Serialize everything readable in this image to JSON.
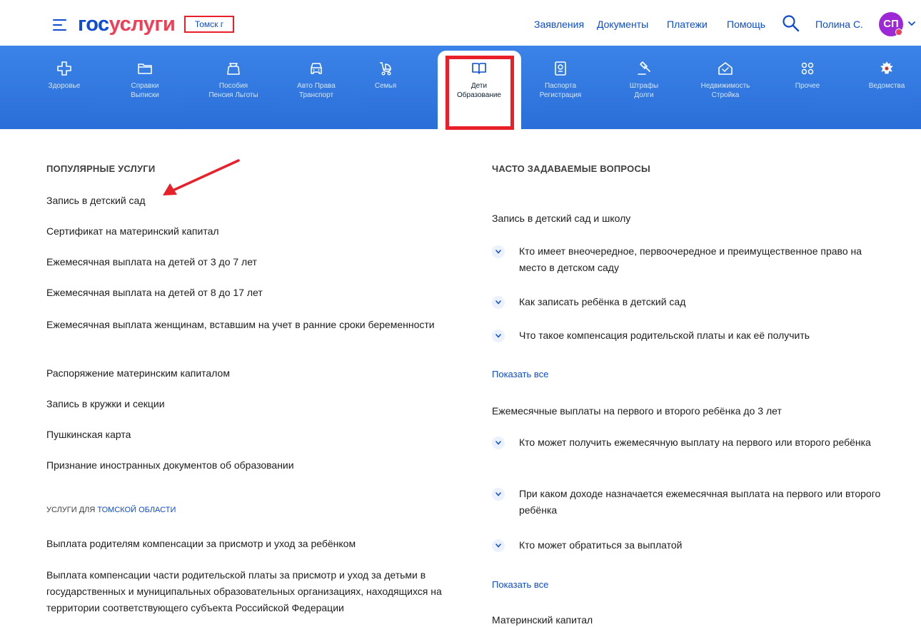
{
  "header": {
    "logo_part1": "гос",
    "logo_part2": "услуги",
    "region": "Томск г",
    "nav": [
      "Заявления",
      "Документы",
      "Платежи",
      "Помощь"
    ],
    "user_name": "Полина С.",
    "avatar_initials": "СП",
    "avatar_color": "#9d29d6"
  },
  "categories": [
    {
      "icon": "medical-cross-icon",
      "line1": "Здоровье",
      "line2": ""
    },
    {
      "icon": "folder-icon",
      "line1": "Справки",
      "line2": "Выписки"
    },
    {
      "icon": "wallet-icon",
      "line1": "Пособия",
      "line2": "Пенсия Льготы"
    },
    {
      "icon": "car-icon",
      "line1": "Авто Права",
      "line2": "Транспорт"
    },
    {
      "icon": "stroller-icon",
      "line1": "Семья",
      "line2": ""
    },
    {
      "icon": "book-icon",
      "line1": "Дети",
      "line2": "Образование"
    },
    {
      "icon": "passport-icon",
      "line1": "Паспорта",
      "line2": "Регистрация"
    },
    {
      "icon": "gavel-icon",
      "line1": "Штрафы",
      "line2": "Долги"
    },
    {
      "icon": "house-icon",
      "line1": "Недвижимость",
      "line2": "Стройка"
    },
    {
      "icon": "grid-icon",
      "line1": "Прочее",
      "line2": ""
    },
    {
      "icon": "emblem-icon",
      "line1": "Ведомства",
      "line2": ""
    }
  ],
  "popular": {
    "title": "ПОПУЛЯРНЫЕ УСЛУГИ",
    "items": [
      "Запись в детский сад",
      "Сертификат на материнский капитал",
      "Ежемесячная выплата на детей от 3 до 7 лет",
      "Ежемесячная выплата на детей от 8 до 17 лет",
      "Ежемесячная выплата женщинам, вставшим на учет в ранние сроки беременности",
      "Распоряжение материнским капиталом",
      "Запись в кружки и секции",
      "Пушкинская карта",
      "Признание иностранных документов об образовании"
    ]
  },
  "regional": {
    "title_prefix": "УСЛУГИ ДЛЯ ",
    "title_region": "ТОМСКОЙ ОБЛАСТИ",
    "items": [
      "Выплата родителям компенсации за присмотр и уход за ребёнком",
      "Выплата компенсации части родительской платы за присмотр и уход за детьми в государственных и муниципальных образовательных организациях, находящихся на территории соответствующего субъекта Российской Федерации"
    ]
  },
  "faq": {
    "title": "ЧАСТО ЗАДАВАЕМЫЕ ВОПРОСЫ",
    "show_all": "Показать все",
    "groups": [
      {
        "name": "Запись в детский сад и школу",
        "questions": [
          "Кто имеет внеочередное, первоочередное и преимущественное право на место в детском саду",
          "Как записать ребёнка в детский сад",
          "Что такое компенсация родительской платы и как её получить"
        ]
      },
      {
        "name": "Ежемесячные выплаты на первого и второго ребёнка до 3 лет",
        "questions": [
          "Кто может получить ежемесячную выплату на первого или второго ребёнка",
          "При каком доходе назначается ежемесячная выплата на первого или второго ребёнка",
          "Кто может обратиться за выплатой"
        ]
      },
      {
        "name": "Материнский капитал",
        "questions": []
      }
    ]
  },
  "colors": {
    "brand_blue": "#0d4cd3",
    "brand_red": "#ee3f58",
    "band": "#2f76e0",
    "annotation_red": "#e8202a"
  }
}
